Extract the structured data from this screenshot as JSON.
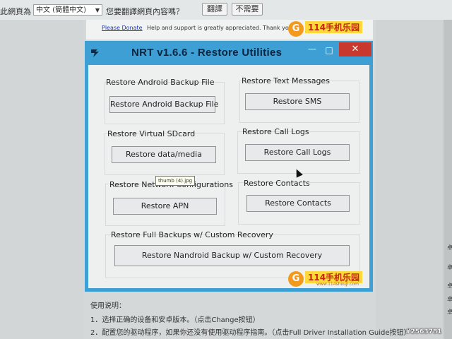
{
  "translate_bar": {
    "prefix": "此網頁為",
    "language": "中文 (簡體中文)",
    "question": "您要翻譯網頁內容嗎？",
    "translate_btn": "翻譯",
    "no_btn": "不需要"
  },
  "donate": {
    "link": "Please Donate",
    "text": "Help and support is greatly appreciated. Thank you!"
  },
  "watermark": {
    "top_text": "114手机乐园",
    "bottom_text": "114手机乐园",
    "sub": "www.114shouji.com",
    "glyph": "G"
  },
  "window": {
    "title": "NRT v1.6.6 - Restore Utilities",
    "minimize": "—",
    "maximize": "□",
    "close": "✕"
  },
  "groups": {
    "android_backup": {
      "title": "Restore Android Backup File",
      "button": "Restore Android Backup File"
    },
    "text_messages": {
      "title": "Restore Text Messages",
      "button": "Restore SMS"
    },
    "sdcard": {
      "title": "Restore Virtual SDcard",
      "button": "Restore data/media"
    },
    "call_logs": {
      "title": "Restore Call Logs",
      "button": "Restore Call Logs"
    },
    "network": {
      "title": "Restore Network Configurations",
      "button": "Restore APN"
    },
    "contacts": {
      "title": "Restore Contacts",
      "button": "Restore Contacts"
    },
    "full_backup": {
      "title": "Restore Full Backups w/ Custom Recovery",
      "button": "Restore Nandroid Backup w/ Custom Recovery"
    }
  },
  "tooltip": "thumb (4).jpg",
  "instructions": {
    "heading": "使用说明：",
    "step1": "1．选择正确的设备和安卓版本。（点击Change按钮）",
    "step2": "2．配置您的驱动程序，如果你还没有使用驱动程序指南。（点击Full Driver Installation Guide按钮）"
  },
  "side_chars": [
    "卓",
    "卓",
    "卓",
    "卓",
    "卓"
  ],
  "photo_id": "#2563781",
  "colors": {
    "titlebar": "#3e9fd4",
    "close": "#c9382d",
    "client": "#eef0f0",
    "link": "#1a37b8"
  }
}
